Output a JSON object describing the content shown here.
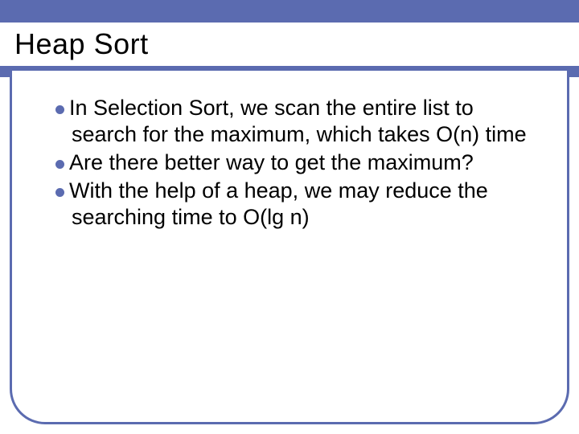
{
  "slide": {
    "title": "Heap Sort",
    "bullets": [
      "In Selection Sort, we scan the entire list to search for the maximum, which takes O(n) time",
      "Are there better way to get the maximum?",
      "With the help of a heap, we may reduce the searching time to O(lg n)"
    ]
  }
}
